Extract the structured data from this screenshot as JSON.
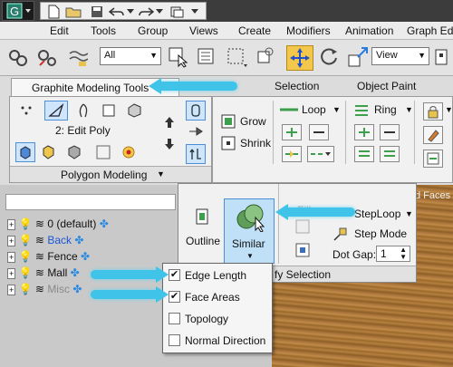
{
  "menu": [
    "Edit",
    "Tools",
    "Group",
    "Views",
    "Create",
    "Modifiers",
    "Animation",
    "Graph Edi"
  ],
  "toolbar": {
    "selection_filter": "All",
    "view_select": "View"
  },
  "ribbon": {
    "tabs": [
      "Graphite Modeling Tools",
      "Selection",
      "Object Paint"
    ],
    "edit_poly_label": "2: Edit Poly",
    "polygon_modeling_label": "Polygon Modeling",
    "grow_label": "Grow",
    "shrink_label": "Shrink",
    "loop_label": "Loop",
    "ring_label": "Ring"
  },
  "modify_panel": {
    "outline_label": "Outline",
    "similar_label": "Similar",
    "fill_label": "Fill",
    "steploop_label": "StepLoop",
    "stepmode_label": "Step Mode",
    "dotgap_label": "Dot Gap:",
    "dotgap_value": "1",
    "section_label": "fy Selection"
  },
  "viewport_text": "d Faces",
  "similar_menu": [
    {
      "label": "Edge Length",
      "checked": true
    },
    {
      "label": "Face Areas",
      "checked": true
    },
    {
      "label": "Topology",
      "checked": false
    },
    {
      "label": "Normal Direction",
      "checked": false
    }
  ],
  "layers": [
    {
      "name": "0 (default)",
      "color": "#111111"
    },
    {
      "name": "Back",
      "color": "#1a57d8"
    },
    {
      "name": "Fence",
      "color": "#111111"
    },
    {
      "name": "Mall",
      "color": "#111111"
    },
    {
      "name": "Misc",
      "color": "#8a8a8a"
    }
  ],
  "colors": {
    "callout": "#3fc3e8",
    "accent_blue": "#2c8be0",
    "viewport": "#a8733a"
  }
}
